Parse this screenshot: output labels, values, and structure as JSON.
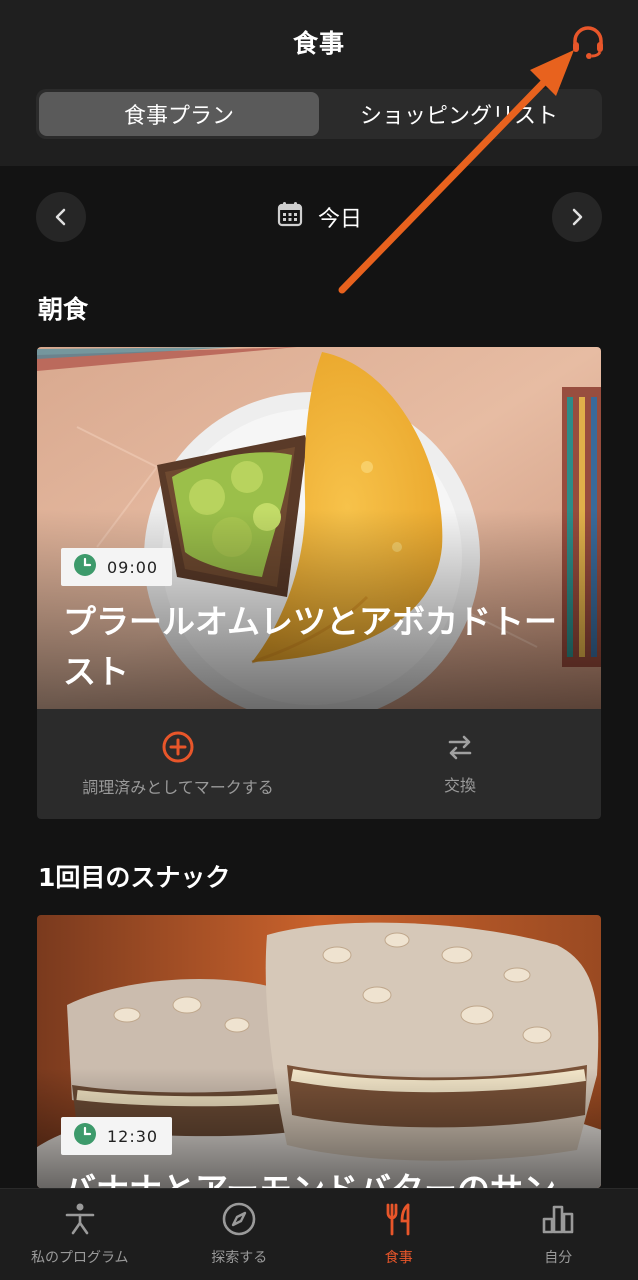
{
  "header": {
    "title": "食事",
    "support_icon": "headset-icon",
    "tabs": [
      {
        "label": "食事プラン",
        "active": true
      },
      {
        "label": "ショッピングリスト",
        "active": false
      }
    ]
  },
  "date_nav": {
    "prev_icon": "chevron-left-icon",
    "next_icon": "chevron-right-icon",
    "calendar_icon": "calendar-icon",
    "label": "今日"
  },
  "sections": [
    {
      "title": "朝食",
      "meal": {
        "time": "09:00",
        "title": "プラールオムレツとアボカドトースト",
        "actions": [
          {
            "label": "調理済みとしてマークする",
            "icon": "plus-circle-icon",
            "color": "#e8562a"
          },
          {
            "label": "交換",
            "icon": "swap-icon",
            "color": "#9a9a9a"
          }
        ]
      }
    },
    {
      "title": "1回目のスナック",
      "meal": {
        "time": "12:30",
        "title": "バナナとアーモンドバターのサン"
      }
    }
  ],
  "tabbar": [
    {
      "label": "私のプログラム",
      "icon": "exercise-icon",
      "active": false
    },
    {
      "label": "探索する",
      "icon": "compass-icon",
      "active": false
    },
    {
      "label": "食事",
      "icon": "fork-knife-icon",
      "active": true
    },
    {
      "label": "自分",
      "icon": "bar-chart-icon",
      "active": false
    }
  ],
  "colors": {
    "accent": "#e8562a",
    "background": "#131313",
    "header": "#1f1f1f",
    "card_actions": "#2b2b2b"
  }
}
